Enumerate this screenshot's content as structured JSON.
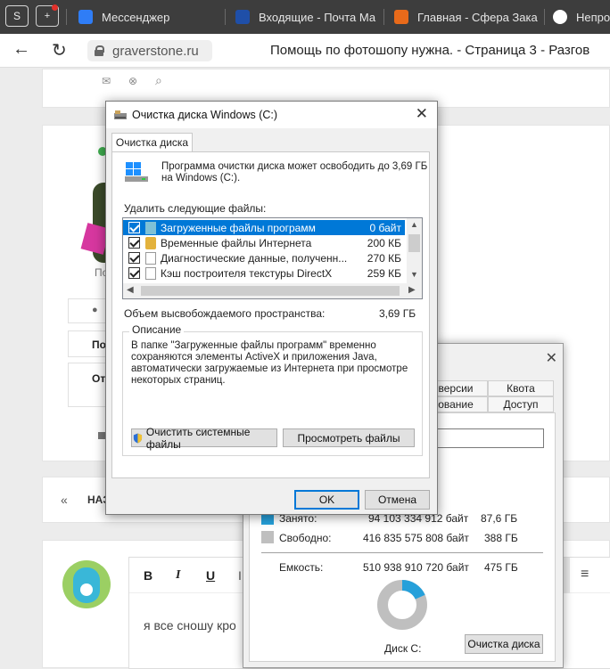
{
  "browser": {
    "tabs": [
      {
        "label": "Мессенджер"
      },
      {
        "label": "Входящие - Почта Ма"
      },
      {
        "label": "Главная - Сфера Зака"
      },
      {
        "label": "Непрo"
      }
    ],
    "url": "graverstone.ru",
    "page_title": "Помощь по фотошопу нужна. - Страница 3 - Разгов"
  },
  "forum": {
    "profile_label_short": "По",
    "btn_po": "По",
    "btn_ot": "От",
    "pager_prev_label": "НАЗ",
    "editor_text": "я все сношу кро",
    "editor_bold": "B",
    "editor_italic": "I",
    "editor_underline": "U"
  },
  "properties_window": {
    "tab_versions": "версии",
    "tab_quota": "Квота",
    "tab_sharing": "ование",
    "tab_access": "Доступ",
    "used_label": "Занято:",
    "used_bytes": "94 103 334 912 байт",
    "used_gb": "87,6 ГБ",
    "free_label": "Свободно:",
    "free_bytes": "416 835 575 808 байт",
    "free_gb": "388 ГБ",
    "capacity_label": "Емкость:",
    "capacity_bytes": "510 938 910 720 байт",
    "capacity_gb": "475 ГБ",
    "disk_label": "Диск C:",
    "cleanup_button": "Очистка диска",
    "used_fraction": 0.184,
    "colors": {
      "used": "#26a0da",
      "free": "#bfbfbf"
    }
  },
  "cleanup_dialog": {
    "title": "Очистка диска Windows (C:)",
    "tab_label": "Очистка диска",
    "intro": "Программа очистки диска может освободить до 3,69 ГБ на Windows (C:).",
    "files_label": "Удалить следующие файлы:",
    "files": [
      {
        "name": "Загруженные файлы программ",
        "size": "0 байт"
      },
      {
        "name": "Временные файлы Интернета",
        "size": "200 КБ"
      },
      {
        "name": "Диагностические данные, полученн...",
        "size": "270 КБ"
      },
      {
        "name": "Кэш построителя текстуры DirectX",
        "size": "259 КБ"
      }
    ],
    "space_label": "Объем высвобождаемого пространства:",
    "space_value": "3,69 ГБ",
    "description_legend": "Описание",
    "description": "В папке \"Загруженные файлы программ\" временно сохраняются элементы ActiveX и приложения Java, автоматически загружаемые из Интернета при просмотре некоторых страниц.",
    "clean_system_button": "Очистить системные файлы",
    "view_files_button": "Просмотреть файлы",
    "ok_button": "OK",
    "cancel_button": "Отмена"
  }
}
